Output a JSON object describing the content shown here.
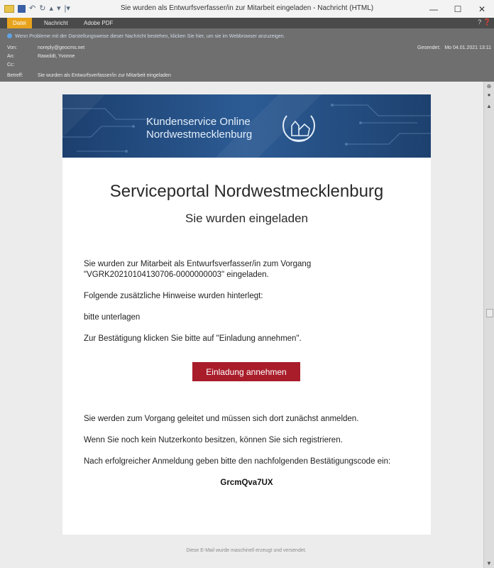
{
  "window": {
    "title": "Sie wurden als Entwurfsverfasser/in zur Mitarbeit eingeladen  -  Nachricht (HTML)",
    "minimize": "—",
    "maximize": "☐",
    "close": "✕"
  },
  "ribbon": {
    "tabs": [
      "Datei",
      "Nachricht",
      "Adobe PDF"
    ],
    "help": "? ❓"
  },
  "header": {
    "info_bar": "Wenn Probleme mit der Darstellungsweise dieser Nachricht bestehen, klicken Sie hier, um sie im Webbrowser anzuzeigen.",
    "from_label": "Von:",
    "from_value": "noreply@geocms.net",
    "to_label": "An:",
    "to_value": "Rawoldt, Yvonne",
    "cc_label": "Cc:",
    "cc_value": "",
    "subject_label": "Betreff:",
    "subject_value": "Sie wurden als Entwurfsverfasser/in zur Mitarbeit eingeladen",
    "sent_label": "Gesendet:",
    "sent_value": "Mo 04.01.2021 13:11"
  },
  "email": {
    "brand_line1": "Kundenservice Online",
    "brand_line2": "Nordwestmecklenburg",
    "title": "Serviceportal Nordwestmecklenburg",
    "subtitle": "Sie wurden eingeladen",
    "p1_line1": "Sie wurden zur Mitarbeit als Entwurfsverfasser/in zum Vorgang",
    "p1_line2": "\"VGRK20210104130706-0000000003\" eingeladen.",
    "p2": "Folgende zusätzliche Hinweise wurden hinterlegt:",
    "p3": "bitte unterlagen",
    "p4": "Zur Bestätigung klicken Sie bitte auf \"Einladung annehmen\".",
    "button": "Einladung annehmen",
    "p5": "Sie werden zum Vorgang geleitet und müssen sich dort zunächst anmelden.",
    "p6": "Wenn Sie noch kein Nutzerkonto besitzen, können Sie sich registrieren.",
    "p7": "Nach erfolgreicher Anmeldung geben bitte den nachfolgenden Bestätigungscode ein:",
    "code": "GrcmQva7UX",
    "footer": "Diese E-Mail wurde maschinell erzeugt und versendet."
  },
  "colors": {
    "button": "#a91d2b",
    "banner": "#214a7e",
    "active_tab": "#e8a31c"
  }
}
